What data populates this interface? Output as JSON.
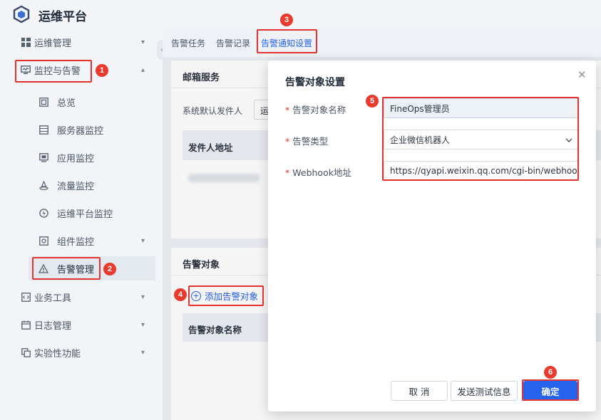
{
  "app": {
    "title": "运维平台",
    "logo_icon": "cube-icon"
  },
  "sidebar": {
    "items": [
      {
        "label": "运维管理",
        "icon": "grid-icon"
      },
      {
        "label": "监控与告警",
        "icon": "monitor-icon"
      },
      {
        "label": "总览",
        "icon": "overview-icon"
      },
      {
        "label": "服务器监控",
        "icon": "server-icon"
      },
      {
        "label": "应用监控",
        "icon": "app-icon"
      },
      {
        "label": "流量监控",
        "icon": "flow-icon"
      },
      {
        "label": "运维平台监控",
        "icon": "platform-icon"
      },
      {
        "label": "组件监控",
        "icon": "component-icon"
      },
      {
        "label": "告警管理",
        "icon": "alert-icon"
      },
      {
        "label": "业务工具",
        "icon": "code-icon"
      },
      {
        "label": "日志管理",
        "icon": "calendar-icon"
      },
      {
        "label": "实验性功能",
        "icon": "lab-icon"
      }
    ]
  },
  "tabs": [
    "告警任务",
    "告警记录",
    "告警通知设置"
  ],
  "mail_section": {
    "title": "邮箱服务",
    "default_sender_label": "系统默认发件人",
    "default_sender_value": "运",
    "col_sender_addr": "发件人地址"
  },
  "alert_target_section": {
    "title": "告警对象",
    "add_button": "添加告警对象",
    "col_name": "告警对象名称"
  },
  "dialog": {
    "title": "告警对象设置",
    "fields": [
      {
        "label": "告警对象名称",
        "value": "FineOps管理员"
      },
      {
        "label": "告警类型",
        "value": "企业微信机器人"
      },
      {
        "label": "Webhook地址",
        "value": "https://qyapi.weixin.qq.com/cgi-bin/webhook/send"
      }
    ],
    "cancel": "取 消",
    "test": "发送测试信息",
    "confirm": "确定"
  },
  "markers": [
    "1",
    "2",
    "3",
    "4",
    "5",
    "6"
  ],
  "colors": {
    "accent": "#2563eb",
    "marker": "#e3332e"
  }
}
